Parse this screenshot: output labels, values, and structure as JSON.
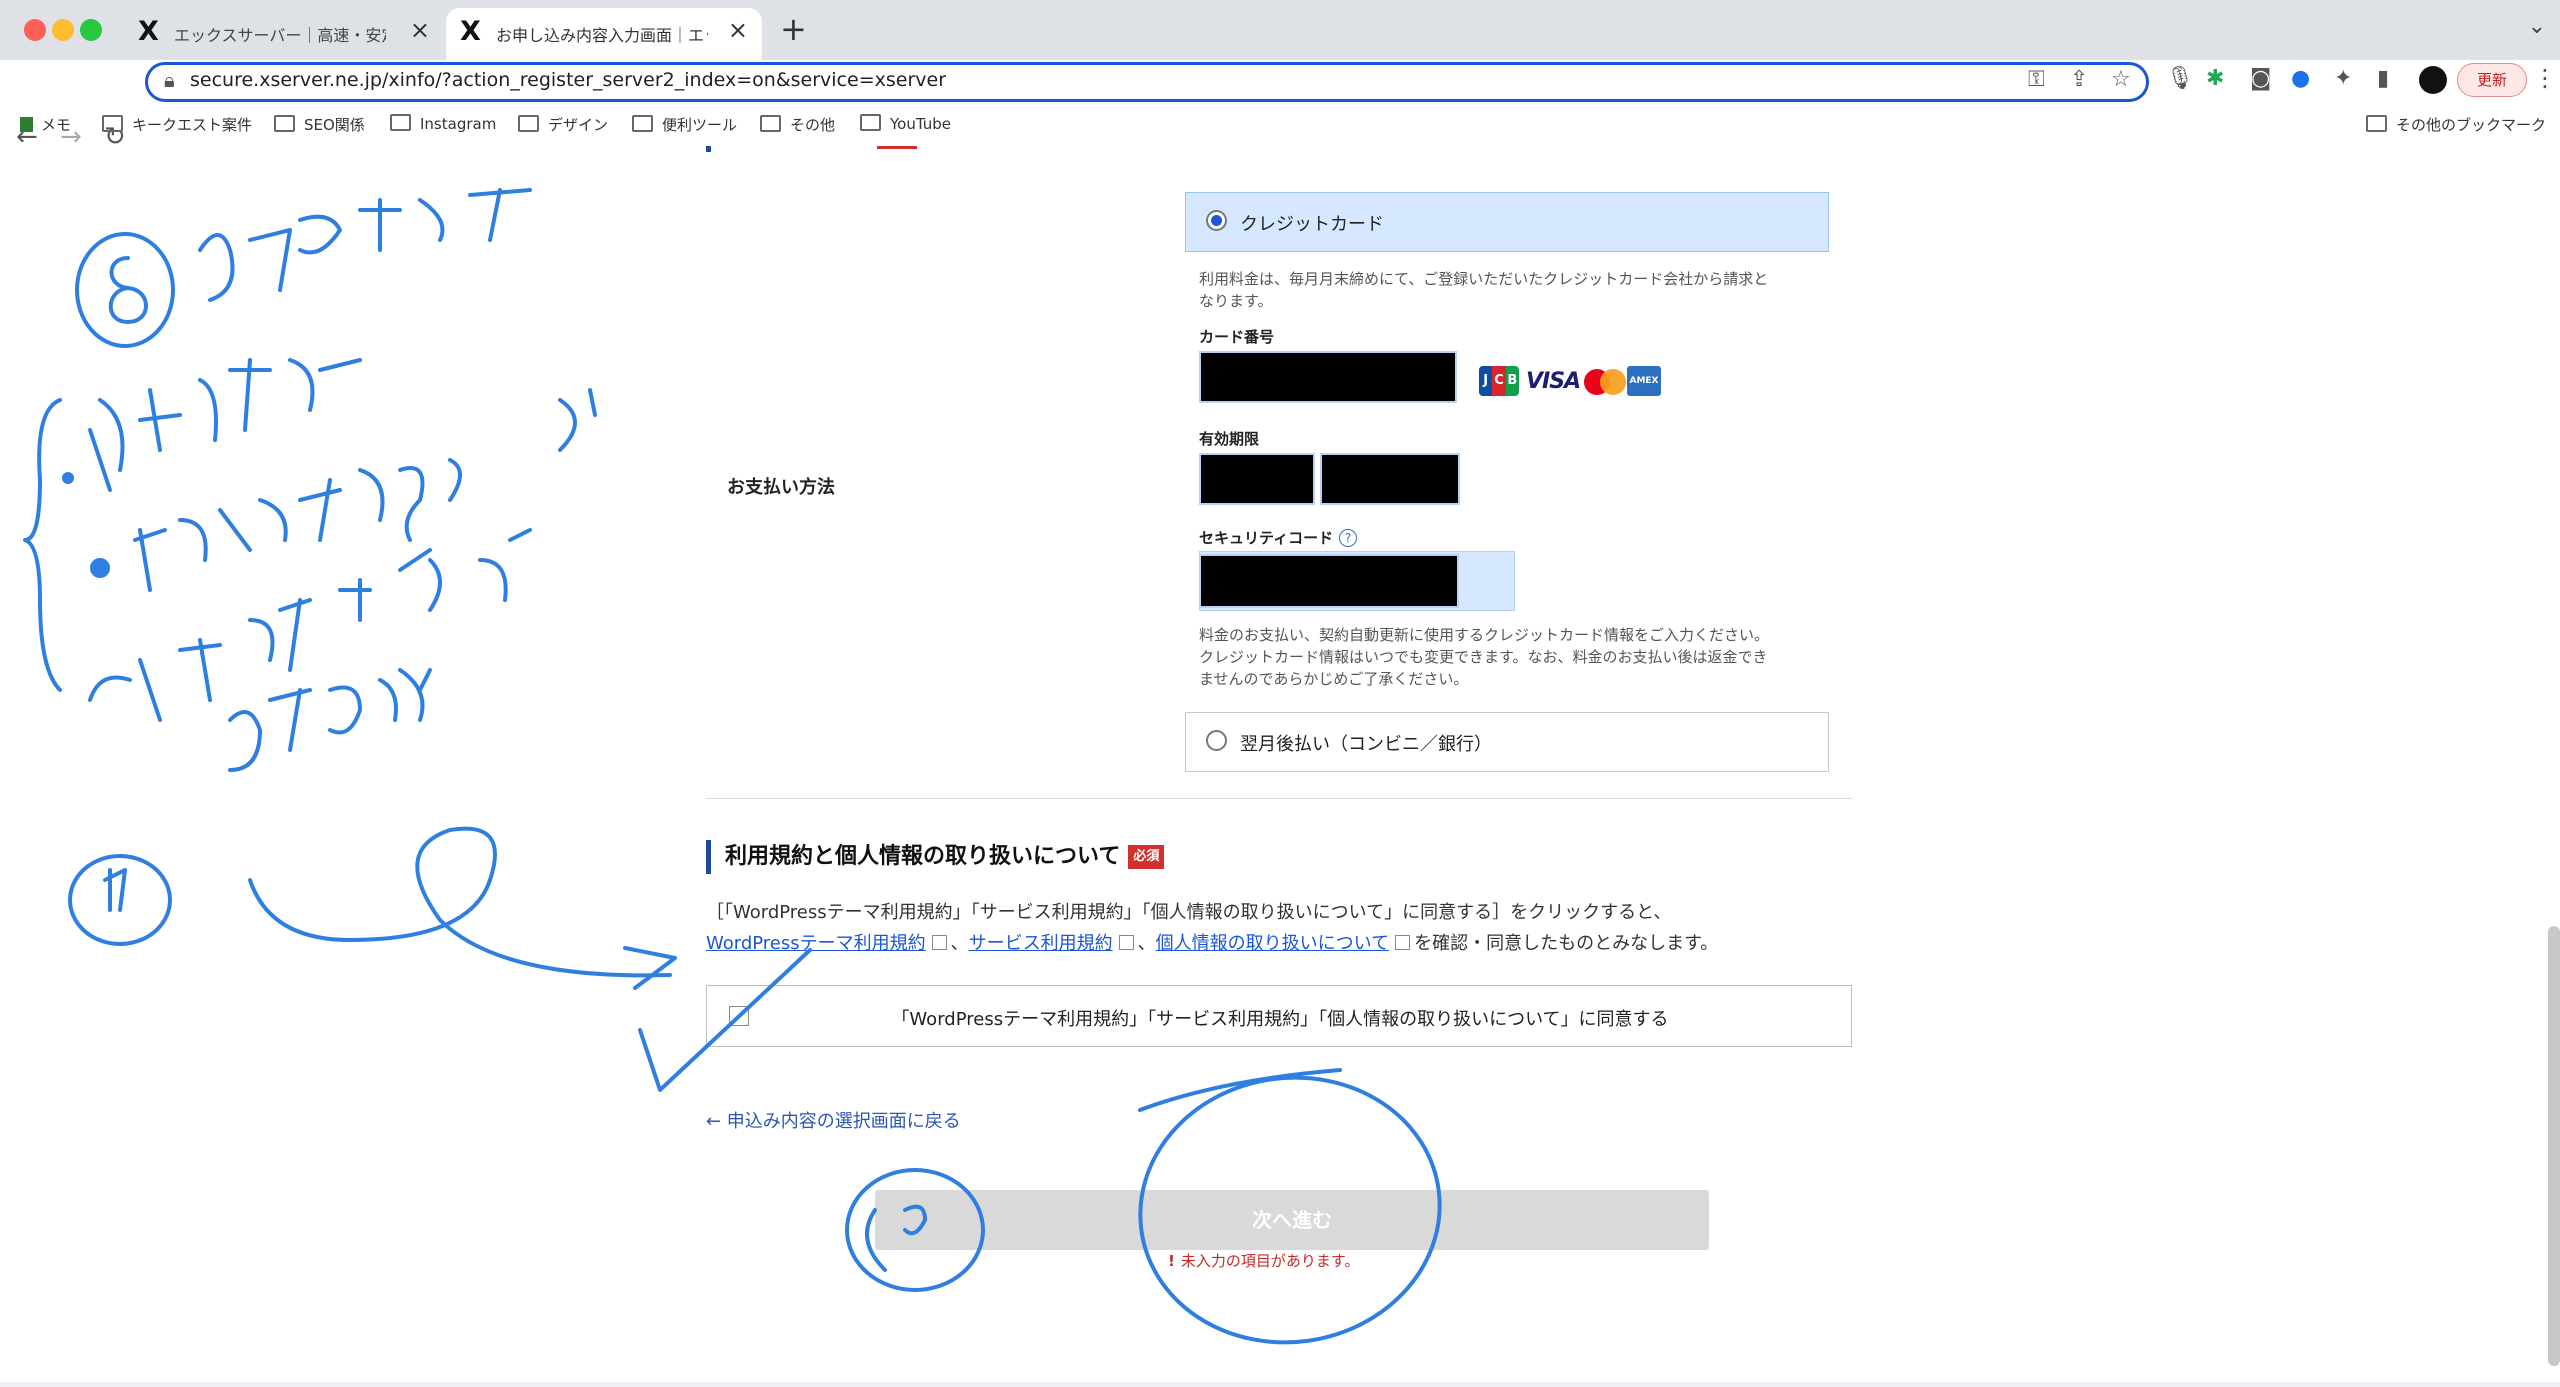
{
  "browser": {
    "tabs": [
      {
        "title": "エックスサーバー｜高速・安定の最",
        "active": false
      },
      {
        "title": "お申し込み内容入力画面｜エックス",
        "active": true
      }
    ],
    "url": "secure.xserver.ne.jp/xinfo/?action_register_server2_index=on&service=xserver",
    "update_label": "更新",
    "bookmarks": [
      "メモ",
      "キークエスト案件",
      "SEO関係",
      "Instagram",
      "デザイン",
      "便利ツール",
      "その他",
      "YouTube"
    ],
    "other_bookmarks": "その他のブックマーク"
  },
  "payment": {
    "label": "お支払い方法",
    "credit": {
      "label": "クレジットカード",
      "selected": true,
      "note_line1": "利用料金は、毎月月末締めにて、ご登録いただいたクレジットカード会社から請求と",
      "note_line2": "なります。",
      "card_number_label": "カード番号",
      "expiry_label": "有効期限",
      "security_label": "セキュリティコード",
      "help": "?",
      "brands": {
        "jcb": [
          "J",
          "C",
          "B"
        ],
        "amex": "AMEX"
      },
      "info_line1": "料金のお支払い、契約自動更新に使用するクレジットカード情報をご入力ください。",
      "info_line2": "クレジットカード情報はいつでも変更できます。なお、料金のお支払い後は返金でき",
      "info_line3": "ませんのであらかじめご了承ください。"
    },
    "deferred": {
      "label": "翌月後払い（コンビニ／銀行）",
      "selected": false
    }
  },
  "terms": {
    "title": "利用規約と個人情報の取り扱いについて",
    "badge": "必須",
    "intro": "［「WordPressテーマ利用規約」「サービス利用規約」「個人情報の取り扱いについて」に同意する］をクリックすると、",
    "links": [
      "WordPressテーマ利用規約",
      "サービス利用規約",
      "個人情報の取り扱いについて"
    ],
    "separator": "、",
    "suffix": "を確認・同意したものとみなします。",
    "agree_label": "「WordPressテーマ利用規約」「サービス利用規約」「個人情報の取り扱いについて」に同意する"
  },
  "back_link": "← 申込み内容の選択画面に戻る",
  "next_button": "次へ進む",
  "error_icon": "!",
  "error": "未入力の項目があります。",
  "colors": {
    "accent": "#1a56d6",
    "required": "#d32f2f",
    "ink": "#2f7fe0"
  }
}
